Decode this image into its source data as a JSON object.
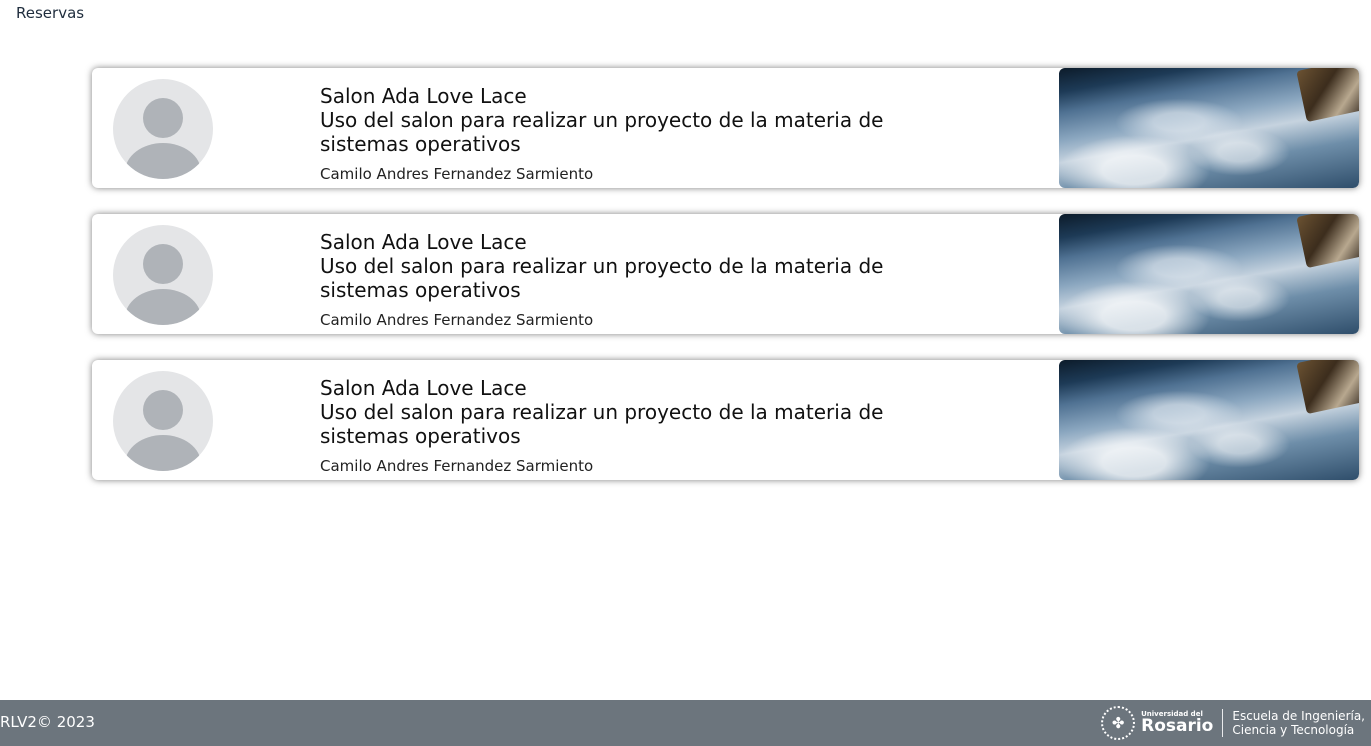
{
  "header": {
    "link_label": "Reservas"
  },
  "reservations": [
    {
      "room": "Salon Ada Love Lace",
      "description": "Uso del salon para realizar un proyecto de la materia de sistemas operativos",
      "owner": "Camilo Andres Fernandez Sarmiento",
      "avatar_icon": "user-avatar-icon",
      "image": "earth-from-space-image"
    },
    {
      "room": "Salon Ada Love Lace",
      "description": "Uso del salon para realizar un proyecto de la materia de sistemas operativos",
      "owner": "Camilo Andres Fernandez Sarmiento",
      "avatar_icon": "user-avatar-icon",
      "image": "earth-from-space-image"
    },
    {
      "room": "Salon Ada Love Lace",
      "description": "Uso del salon para realizar un proyecto de la materia de sistemas operativos",
      "owner": "Camilo Andres Fernandez Sarmiento",
      "avatar_icon": "user-avatar-icon",
      "image": "earth-from-space-image"
    }
  ],
  "footer": {
    "copyright": "RLV2© 2023",
    "logo": {
      "university_small": "Universidad del",
      "university_big": "Rosario",
      "school_line1": "Escuela de Ingeniería,",
      "school_line2": "Ciencia y Tecnología"
    },
    "background_color": "#6c757d"
  }
}
